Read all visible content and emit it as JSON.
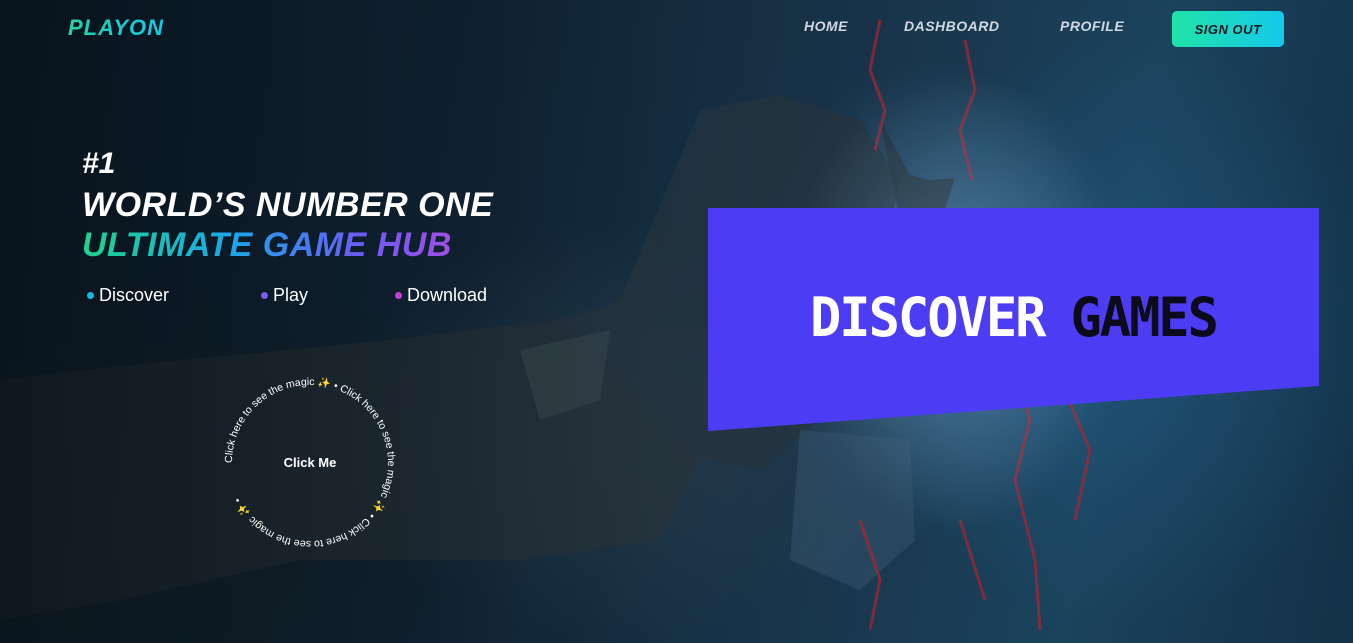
{
  "brand": {
    "logo": "PLAYON"
  },
  "nav": {
    "items": [
      {
        "label": "HOME"
      },
      {
        "label": "DASHBOARD"
      },
      {
        "label": "PROFILE"
      }
    ],
    "sign_out": "SIGN OUT"
  },
  "hero": {
    "rank": "#1",
    "line1": "WORLD’S NUMBER ONE",
    "line2": "ULTIMATE GAME HUB",
    "features": [
      {
        "label": "Discover",
        "dot_color": "#1ab8e0"
      },
      {
        "label": "Play",
        "dot_color": "#7b5cf0"
      },
      {
        "label": "Download",
        "dot_color": "#c640d8"
      }
    ]
  },
  "magic_button": {
    "center_label": "Click Me",
    "ring_text": "Click here to see the magic ✨ • Click here to see the magic ✨ • Click here to see the magic ✨ • "
  },
  "banner": {
    "word1": "DISCOVER",
    "word2": "GAMES",
    "color": "#4c3cf3"
  }
}
